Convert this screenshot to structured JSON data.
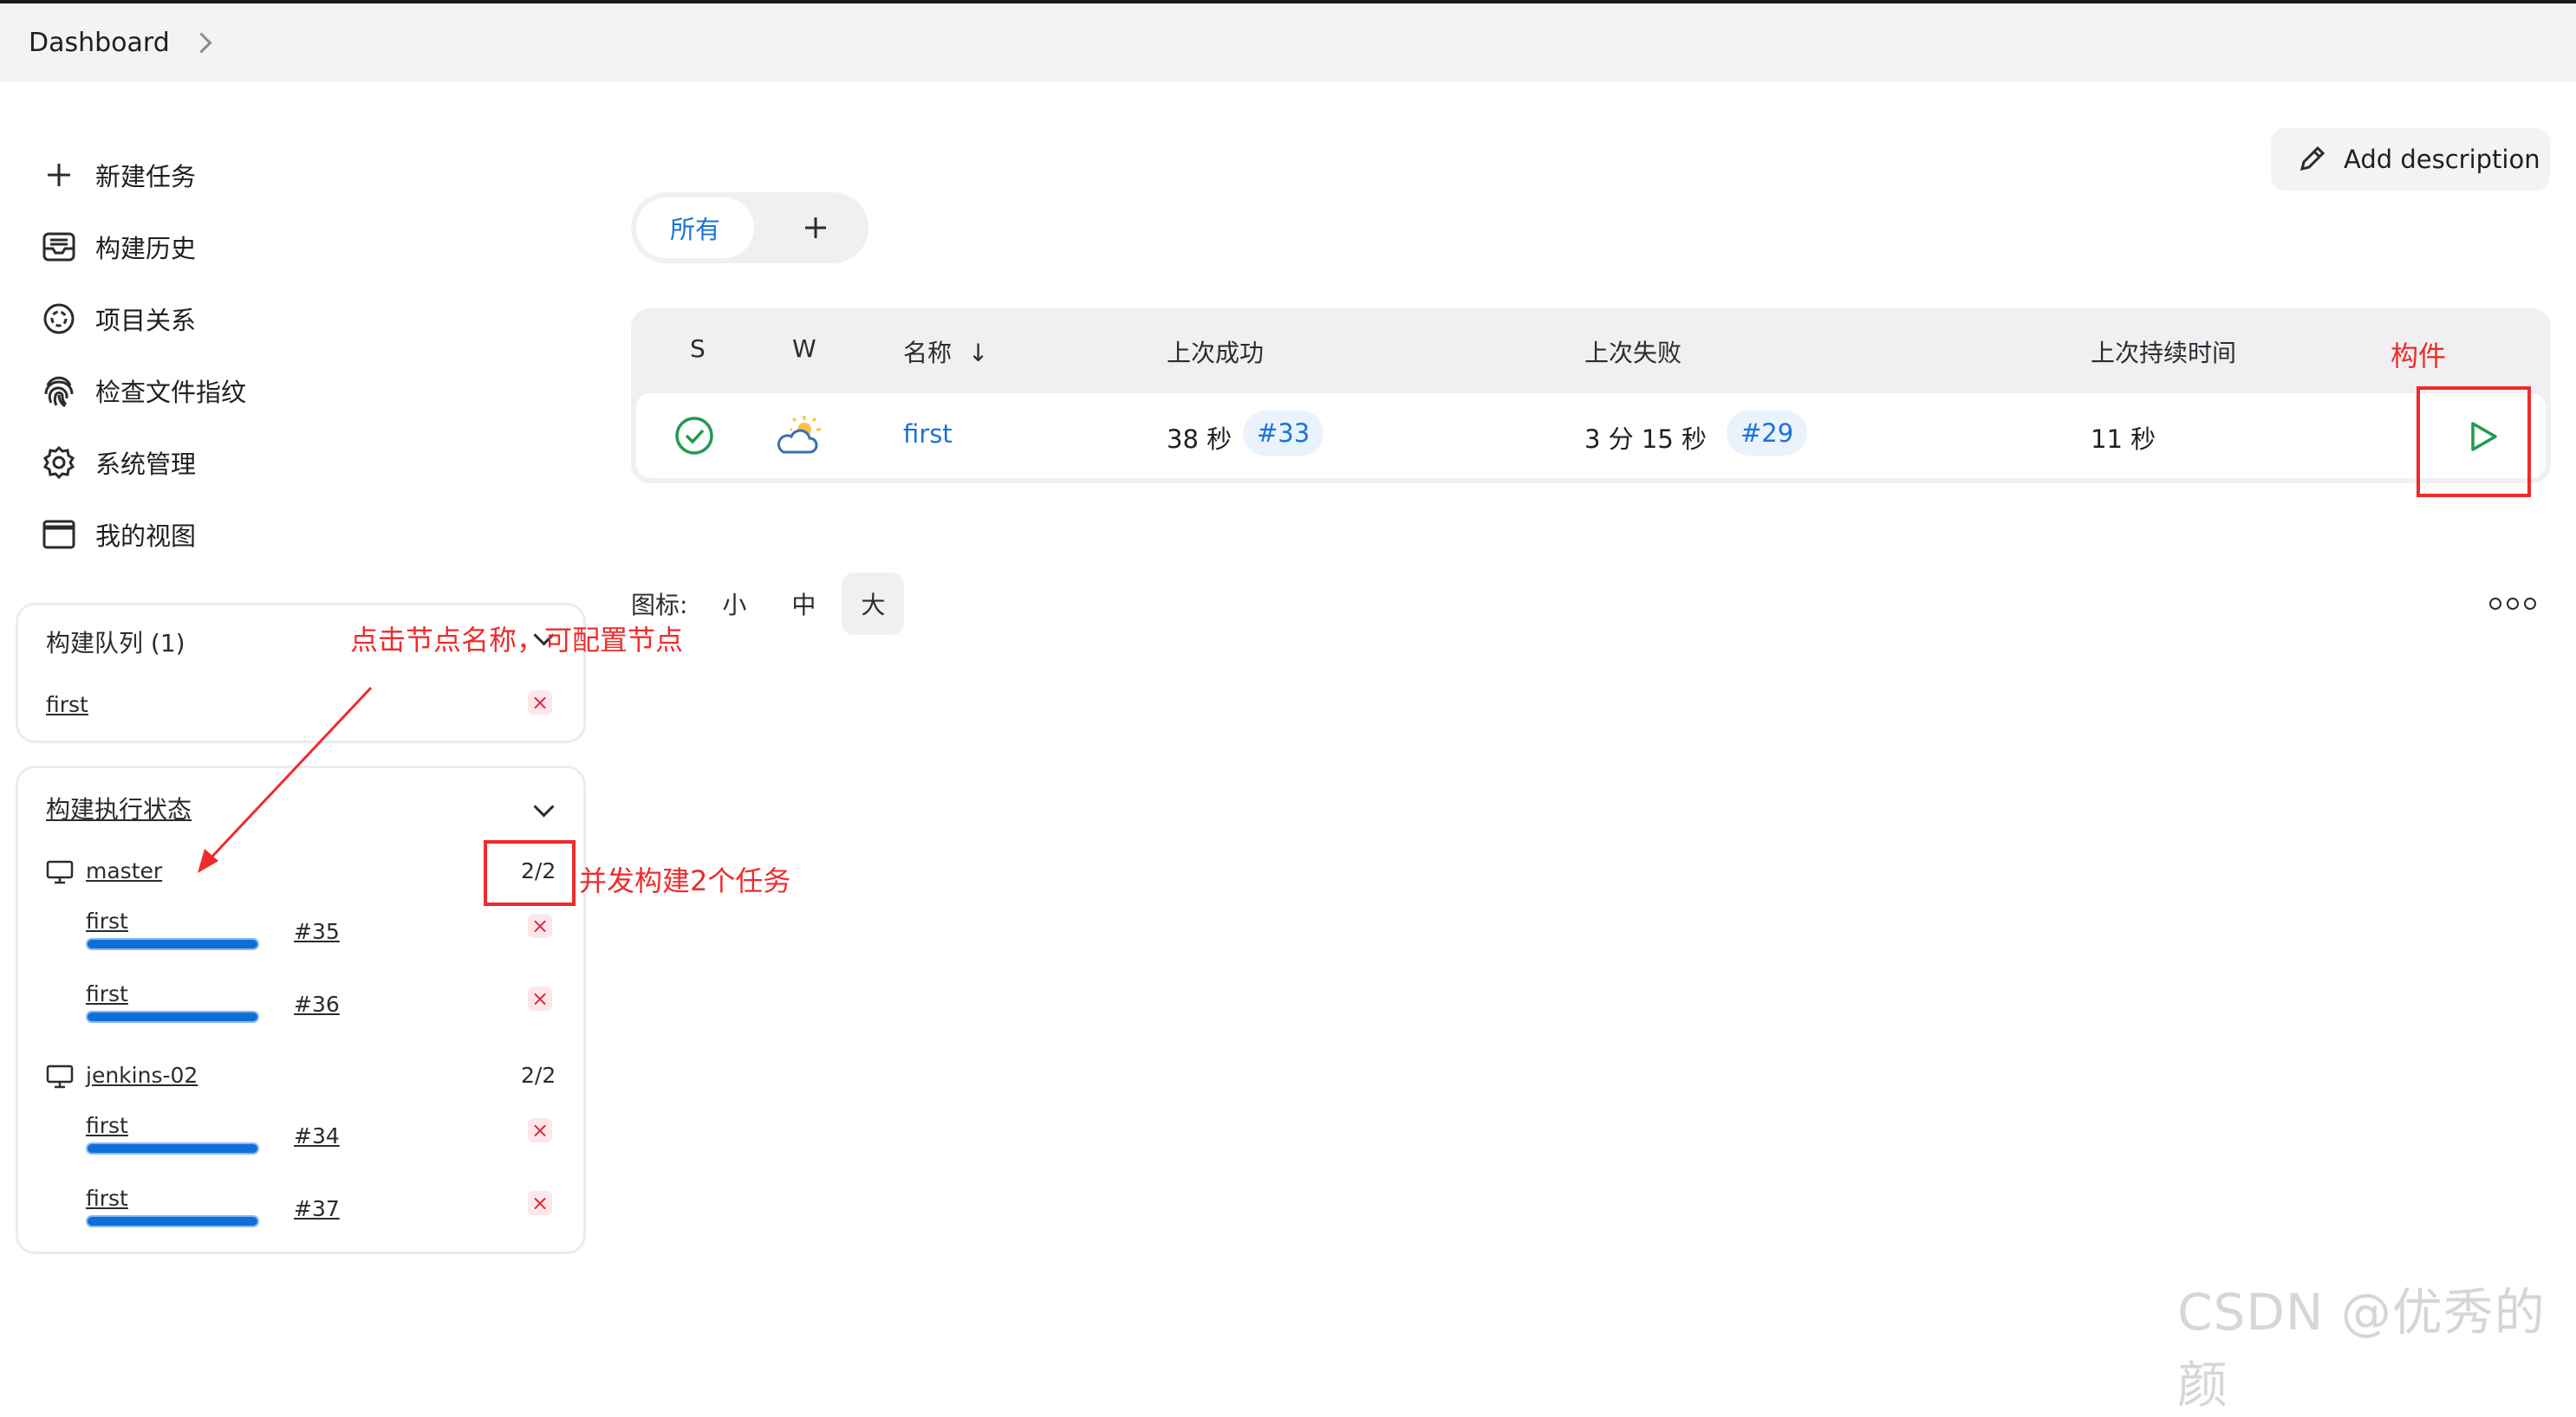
{
  "breadcrumb": {
    "root": "Dashboard"
  },
  "tasks": [
    {
      "label": "新建任务",
      "icon": "plus-icon"
    },
    {
      "label": "构建历史",
      "icon": "inbox-icon"
    },
    {
      "label": "项目关系",
      "icon": "relationship-icon"
    },
    {
      "label": "检查文件指纹",
      "icon": "fingerprint-icon"
    },
    {
      "label": "系统管理",
      "icon": "gear-icon"
    },
    {
      "label": "我的视图",
      "icon": "window-icon"
    }
  ],
  "build_queue": {
    "title": "构建队列 (1)",
    "items": [
      "first"
    ]
  },
  "executors": {
    "title": "构建执行状态",
    "nodes": [
      {
        "name": "master",
        "count": "2/2",
        "builds": [
          {
            "job": "first",
            "build": "#35"
          },
          {
            "job": "first",
            "build": "#36"
          }
        ]
      },
      {
        "name": "jenkins-02",
        "count": "2/2",
        "builds": [
          {
            "job": "first",
            "build": "#34"
          },
          {
            "job": "first",
            "build": "#37"
          }
        ]
      }
    ]
  },
  "main": {
    "add_description": "Add description",
    "tab_all": "所有",
    "table": {
      "headers": {
        "s": "S",
        "w": "W",
        "name": "名称",
        "sort": "↓",
        "last_success": "上次成功",
        "last_failure": "上次失败",
        "last_duration": "上次持续时间"
      },
      "rows": [
        {
          "status": "success",
          "weather": "partly-cloudy",
          "name": "first",
          "last_success": "38 秒",
          "success_build": "#33",
          "last_failure": "3 分 15 秒",
          "failure_build": "#29",
          "duration": "11 秒"
        }
      ]
    },
    "icon_size_label": "图标:",
    "icon_sizes": [
      "小",
      "中",
      "大"
    ],
    "icon_size_active": "大"
  },
  "annotations": {
    "build_label": "构件",
    "node_hint": "点击节点名称，可配置节点",
    "concurrent_hint": "并发构建2个任务"
  },
  "watermark": "CSDN @优秀的颜",
  "colors": {
    "accent": "#1a73d9",
    "success": "#1e9b4d",
    "annotation": "#ef2b2b",
    "progress": "#0f6fd9"
  }
}
